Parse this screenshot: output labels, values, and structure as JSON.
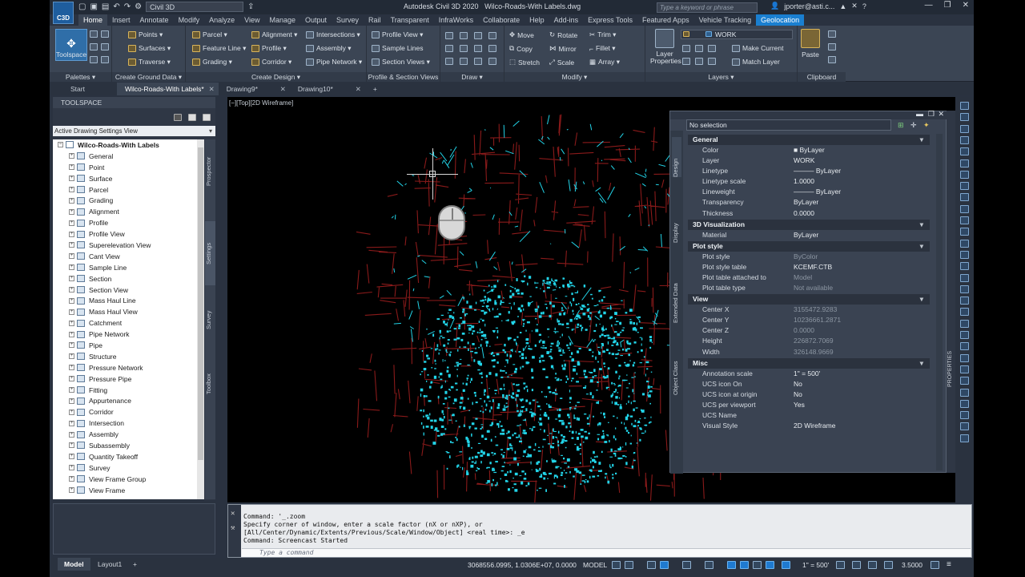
{
  "app": {
    "logo_text": "C3D",
    "workspace": "Civil 3D",
    "title_app": "Autodesk Civil 3D 2020",
    "title_file": "Wilco-Roads-With Labels.dwg",
    "search_placeholder": "Type a keyword or phrase",
    "user": "jporter@asti.c..."
  },
  "ribbon_tabs": [
    "Home",
    "Insert",
    "Annotate",
    "Modify",
    "Analyze",
    "View",
    "Manage",
    "Output",
    "Survey",
    "Rail",
    "Transparent",
    "InfraWorks",
    "Collaborate",
    "Help",
    "Add-ins",
    "Express Tools",
    "Featured Apps",
    "Vehicle Tracking",
    "Geolocation"
  ],
  "ribbon": {
    "toolspace": "Toolspace",
    "palettes": "Palettes ▾",
    "create_ground": {
      "title": "Create Ground Data ▾",
      "items": [
        "Points ▾",
        "Surfaces ▾",
        "Traverse ▾"
      ]
    },
    "create_design": {
      "title": "Create Design ▾",
      "col1": [
        "Parcel ▾",
        "Feature Line ▾",
        "Grading ▾"
      ],
      "col2": [
        "Alignment ▾",
        "Profile ▾",
        "Corridor ▾"
      ],
      "col3": [
        "Intersections ▾",
        "Assembly ▾",
        "Pipe Network ▾"
      ]
    },
    "profile_section": {
      "title": "Profile & Section Views",
      "items": [
        "Profile View ▾",
        "Sample Lines",
        "Section Views ▾"
      ]
    },
    "draw": {
      "title": "Draw ▾"
    },
    "modify": {
      "title": "Modify ▾",
      "col1": [
        "Move",
        "Copy",
        "Stretch"
      ],
      "col2": [
        "Rotate",
        "Mirror",
        "Scale"
      ],
      "col3": [
        "Trim ▾",
        "Fillet ▾",
        "Array ▾"
      ]
    },
    "layers": {
      "title": "Layers ▾",
      "layer_props": "Layer Properties",
      "current_layer": "WORK",
      "items": [
        "Make Current",
        "Match Layer"
      ]
    },
    "clipboard": {
      "title": "Clipboard",
      "paste": "Paste"
    }
  },
  "doc_tabs": [
    "Start",
    "Wilco-Roads-With Labels*",
    "Drawing9*",
    "Drawing10*"
  ],
  "toolspace": {
    "header": "TOOLSPACE",
    "view_select": "Active Drawing Settings View",
    "root": "Wilco-Roads-With Labels",
    "items": [
      "General",
      "Point",
      "Surface",
      "Parcel",
      "Grading",
      "Alignment",
      "Profile",
      "Profile View",
      "Superelevation View",
      "Cant View",
      "Sample Line",
      "Section",
      "Section View",
      "Mass Haul Line",
      "Mass Haul View",
      "Catchment",
      "Pipe Network",
      "Pipe",
      "Structure",
      "Pressure Network",
      "Pressure Pipe",
      "Fitting",
      "Appurtenance",
      "Corridor",
      "Intersection",
      "Assembly",
      "Subassembly",
      "Quantity Takeoff",
      "Survey",
      "View Frame Group",
      "View Frame"
    ],
    "side_tabs": [
      "Prospector",
      "Settings",
      "Survey",
      "Toolbox"
    ]
  },
  "viewport": {
    "label": "[−][Top][2D Wireframe]"
  },
  "properties": {
    "selection": "No selection",
    "vertical_tabs": [
      "Design",
      "Display",
      "Extended Data",
      "Object Class"
    ],
    "panel_label": "PROPERTIES",
    "sections": [
      {
        "name": "General",
        "rows": [
          [
            "Color",
            "■ ByLayer"
          ],
          [
            "Layer",
            "WORK"
          ],
          [
            "Linetype",
            "——— ByLayer"
          ],
          [
            "Linetype scale",
            "1.0000"
          ],
          [
            "Lineweight",
            "——— ByLayer"
          ],
          [
            "Transparency",
            "ByLayer"
          ],
          [
            "Thickness",
            "0.0000"
          ]
        ]
      },
      {
        "name": "3D Visualization",
        "rows": [
          [
            "Material",
            "ByLayer"
          ]
        ]
      },
      {
        "name": "Plot style",
        "rows": [
          [
            "Plot style",
            "ByColor"
          ],
          [
            "Plot style table",
            "KCEMF.CTB"
          ],
          [
            "Plot table attached to",
            "Model"
          ],
          [
            "Plot table type",
            "Not available"
          ]
        ]
      },
      {
        "name": "View",
        "rows": [
          [
            "Center X",
            "3155472.9283"
          ],
          [
            "Center Y",
            "10236661.2871"
          ],
          [
            "Center Z",
            "0.0000"
          ],
          [
            "Height",
            "226872.7069"
          ],
          [
            "Width",
            "326148.9669"
          ]
        ]
      },
      {
        "name": "Misc",
        "rows": [
          [
            "Annotation scale",
            "1\" = 500'"
          ],
          [
            "UCS icon On",
            "No"
          ],
          [
            "UCS icon at origin",
            "No"
          ],
          [
            "UCS per viewport",
            "Yes"
          ],
          [
            "UCS Name",
            ""
          ],
          [
            "Visual Style",
            "2D Wireframe"
          ]
        ]
      }
    ]
  },
  "command": {
    "lines": [
      "Command: '_.zoom",
      "Specify corner of window, enter a scale factor (nX or nXP), or",
      "[All/Center/Dynamic/Extents/Previous/Scale/Window/Object] <real time>: _e",
      "Command: Screencast Started"
    ],
    "placeholder": "Type a command"
  },
  "status": {
    "tabs": [
      "Model",
      "Layout1",
      "+"
    ],
    "coords": "3068556.0995, 1.0306E+07, 0.0000",
    "model": "MODEL",
    "scale": "1\" = 500'",
    "value": "3.5000"
  },
  "colors": {
    "roads": "#8a1a1a",
    "water": "#22d4e8",
    "accent": "#1a7fd0"
  }
}
